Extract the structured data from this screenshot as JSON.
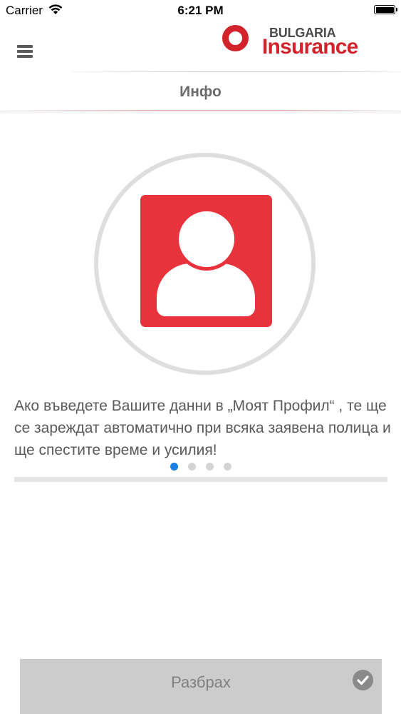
{
  "status_bar": {
    "carrier": "Carrier",
    "time": "6:21 PM"
  },
  "header": {
    "brand_top": "BULGARIA",
    "brand_main": "Insurance",
    "brand_color": "#d2232a",
    "menu_icon": "hamburger-menu-icon"
  },
  "page": {
    "title": "Инфо"
  },
  "onboarding": {
    "icon": "profile-user-icon",
    "icon_color": "#e8323c",
    "text": "Ако въведете Вашите данни в „Моят Профил“ , те ще се зареждат автоматично при всяка заявена полица и ще спестите време и усилия!",
    "total_pages": 4,
    "current_page": 1,
    "active_dot_color": "#1a7fe6"
  },
  "footer": {
    "button_label": "Разбрах",
    "button_icon": "checkmark-circle-icon"
  }
}
